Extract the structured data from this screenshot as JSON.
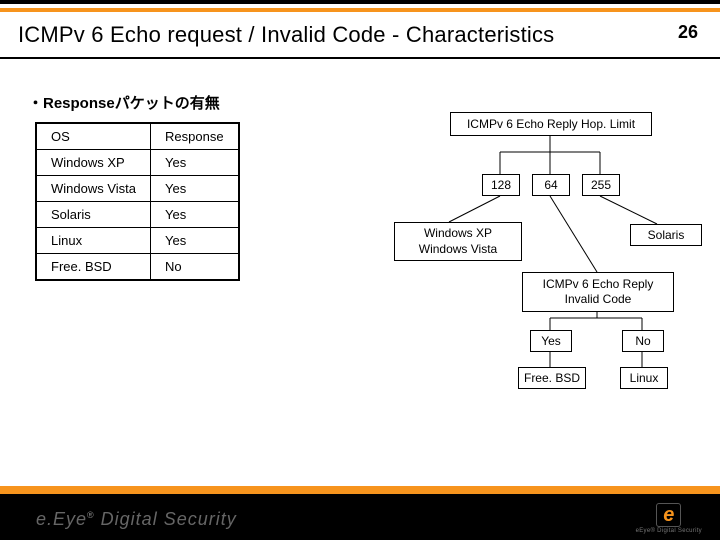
{
  "page_number": "26",
  "title": "ICMPv 6 Echo request / Invalid Code - Characteristics",
  "section_label": "・Responseパケットの有無",
  "table": {
    "headers": {
      "os": "OS",
      "resp": "Response"
    },
    "rows": [
      {
        "os": "Windows XP",
        "resp": "Yes"
      },
      {
        "os": "Windows Vista",
        "resp": "Yes"
      },
      {
        "os": "Solaris",
        "resp": "Yes"
      },
      {
        "os": "Linux",
        "resp": "Yes"
      },
      {
        "os": "Free. BSD",
        "resp": "No"
      }
    ]
  },
  "diagram": {
    "root": "ICMPv 6 Echo Reply Hop. Limit",
    "vals": {
      "a": "128",
      "b": "64",
      "c": "255"
    },
    "group_win": "Windows XP\nWindows Vista",
    "group_sol": "Solaris",
    "sub": "ICMPv 6 Echo Reply\nInvalid Code",
    "yes": "Yes",
    "no": "No",
    "leaf_fb": "Free. BSD",
    "leaf_lx": "Linux"
  },
  "footer": {
    "brand_prefix": "e.Eye",
    "brand_reg": "®",
    "brand_suffix": " Digital Security",
    "logo_e": "e",
    "logo_sub": "eEye® Digital Security"
  }
}
